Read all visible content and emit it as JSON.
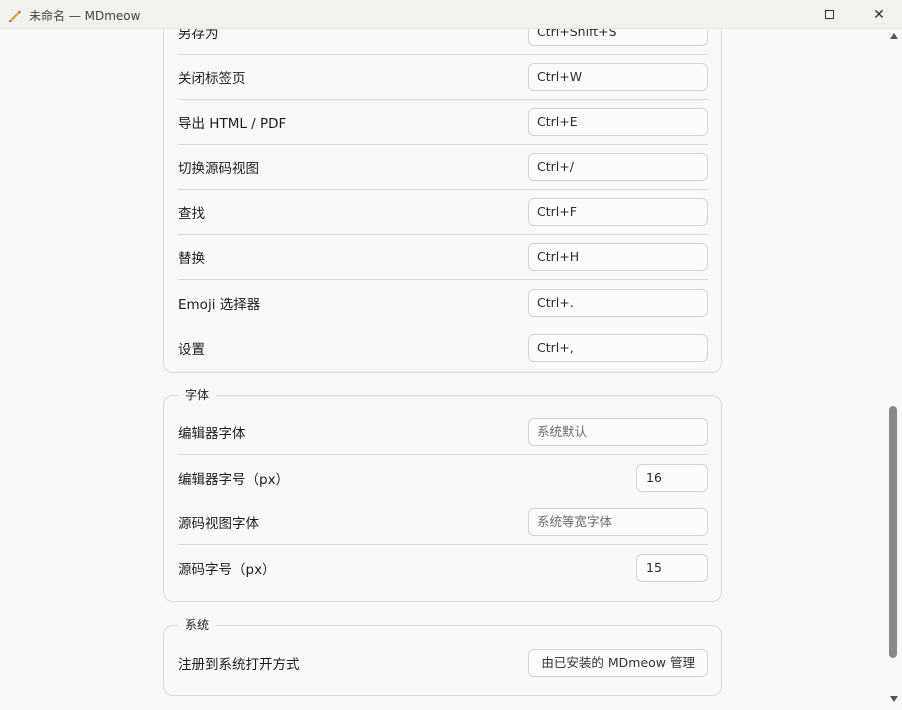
{
  "window": {
    "title": "未命名 — MDmeow",
    "maximize_glyph": "",
    "close_glyph": "✕"
  },
  "shortcuts": {
    "partial_row": {
      "label": "另存为",
      "value": "Ctrl+Shift+S"
    },
    "rows": [
      {
        "label": "关闭标签页",
        "value": "Ctrl+W"
      },
      {
        "label": "导出 HTML / PDF",
        "value": "Ctrl+E"
      },
      {
        "label": "切换源码视图",
        "value": "Ctrl+/"
      },
      {
        "label": "查找",
        "value": "Ctrl+F"
      },
      {
        "label": "替换",
        "value": "Ctrl+H"
      },
      {
        "label": "Emoji 选择器",
        "value": "Ctrl+."
      },
      {
        "label": "设置",
        "value": "Ctrl+,"
      }
    ]
  },
  "font_section": {
    "title": "字体",
    "editor_font_label": "编辑器字体",
    "editor_font_placeholder": "系统默认",
    "editor_size_label": "编辑器字号（px）",
    "editor_size_value": "16",
    "source_font_label": "源码视图字体",
    "source_font_placeholder": "系统等宽字体",
    "source_size_label": "源码字号（px）",
    "source_size_value": "15"
  },
  "system_section": {
    "title": "系统",
    "register_label": "注册到系统打开方式",
    "register_button": "由已安装的 MDmeow 管理"
  },
  "colors": {
    "background": "#faf9f7",
    "titlebar": "#f3f1ee",
    "border": "#dcd9d5",
    "scroll_thumb": "#8a8a8a"
  },
  "icons": {
    "app": "pen-icon",
    "maximize": "maximize-icon",
    "close": "close-icon"
  }
}
